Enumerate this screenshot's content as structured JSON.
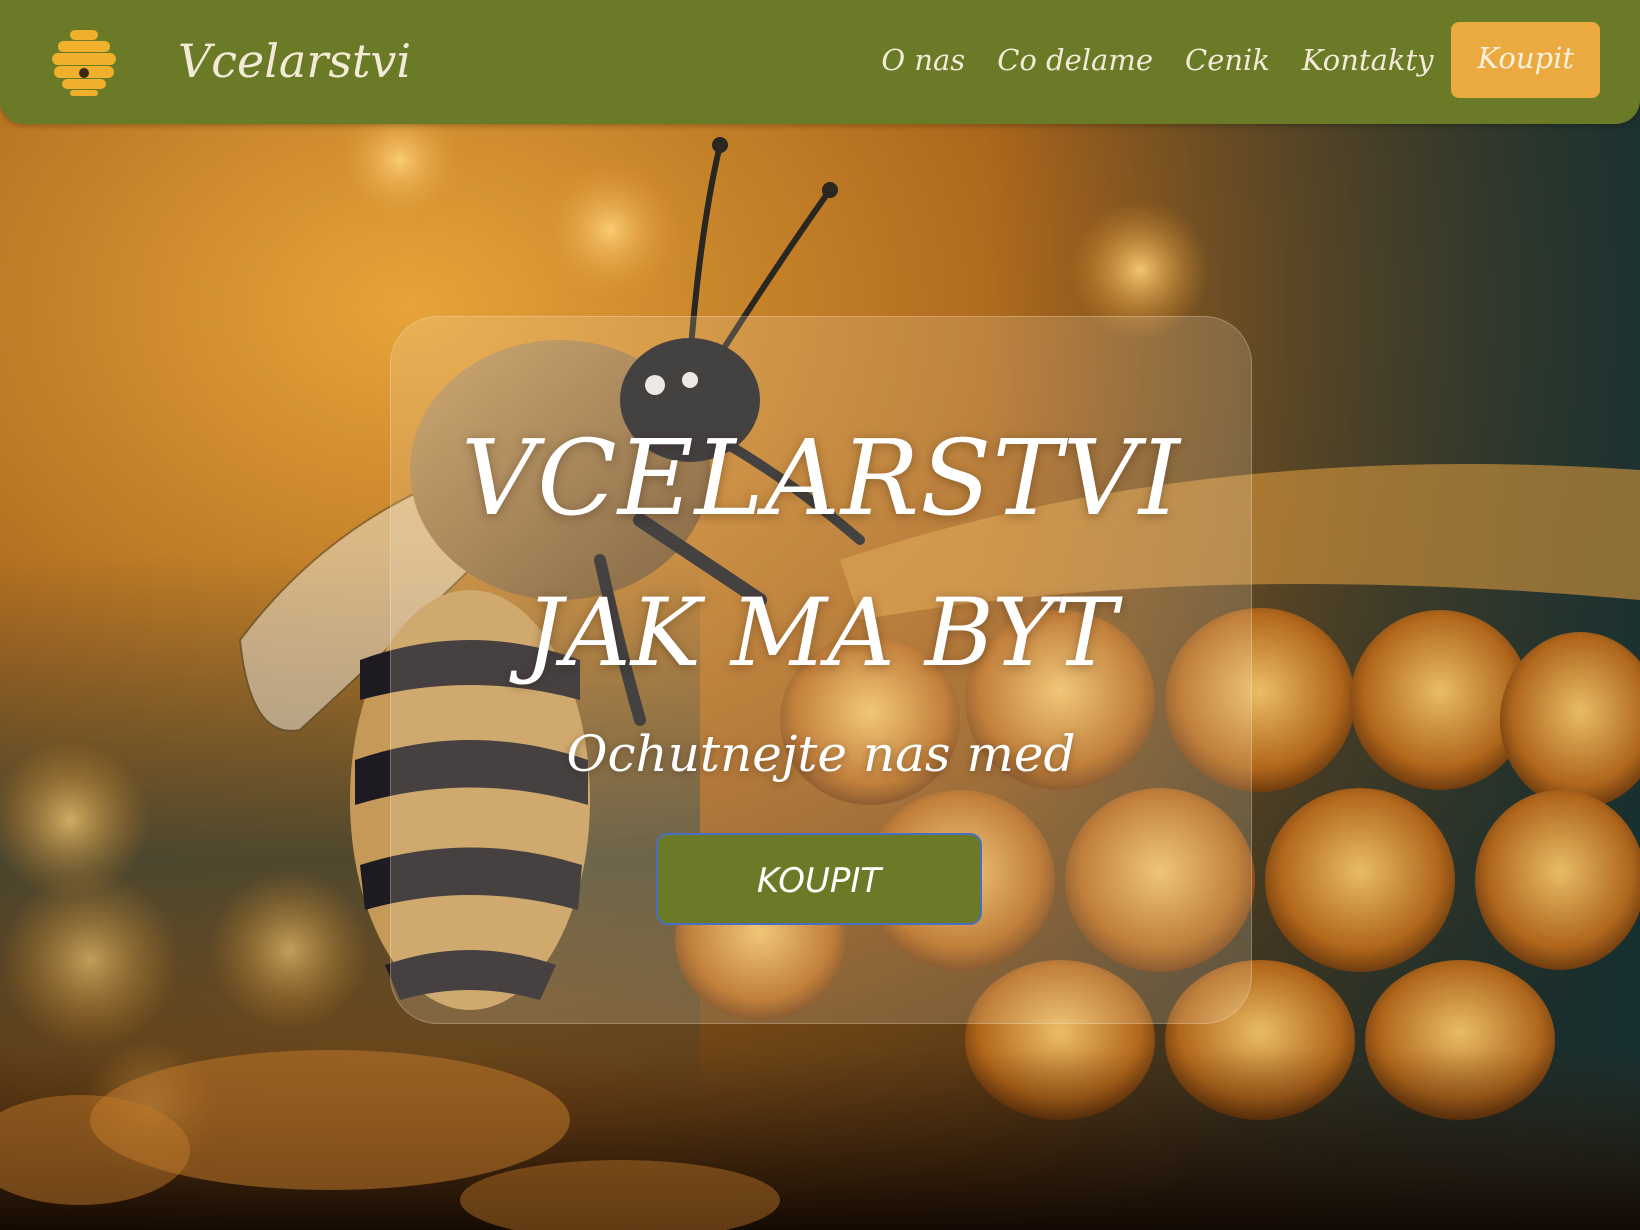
{
  "header": {
    "brand": "Vcelarstvi",
    "logo_icon": "beehive-icon",
    "nav": [
      {
        "label": "O nas"
      },
      {
        "label": "Co delame"
      },
      {
        "label": "Cenik"
      },
      {
        "label": "Kontakty"
      }
    ],
    "buy_label": "Koupit"
  },
  "hero": {
    "title_line1": "VCELARSTVI",
    "title_line2": "JAK MA BYT",
    "subtitle": "Ochutnejte nas med",
    "button_label": "KOUPIT",
    "background_image": "bee-on-honeycomb"
  },
  "colors": {
    "header_bg": "#6b7a27",
    "buy_button_bg": "#eaaa40",
    "hero_button_bg": "#6b7a27",
    "hero_button_border": "#4a6fc0",
    "text_light": "#f4ead8"
  }
}
